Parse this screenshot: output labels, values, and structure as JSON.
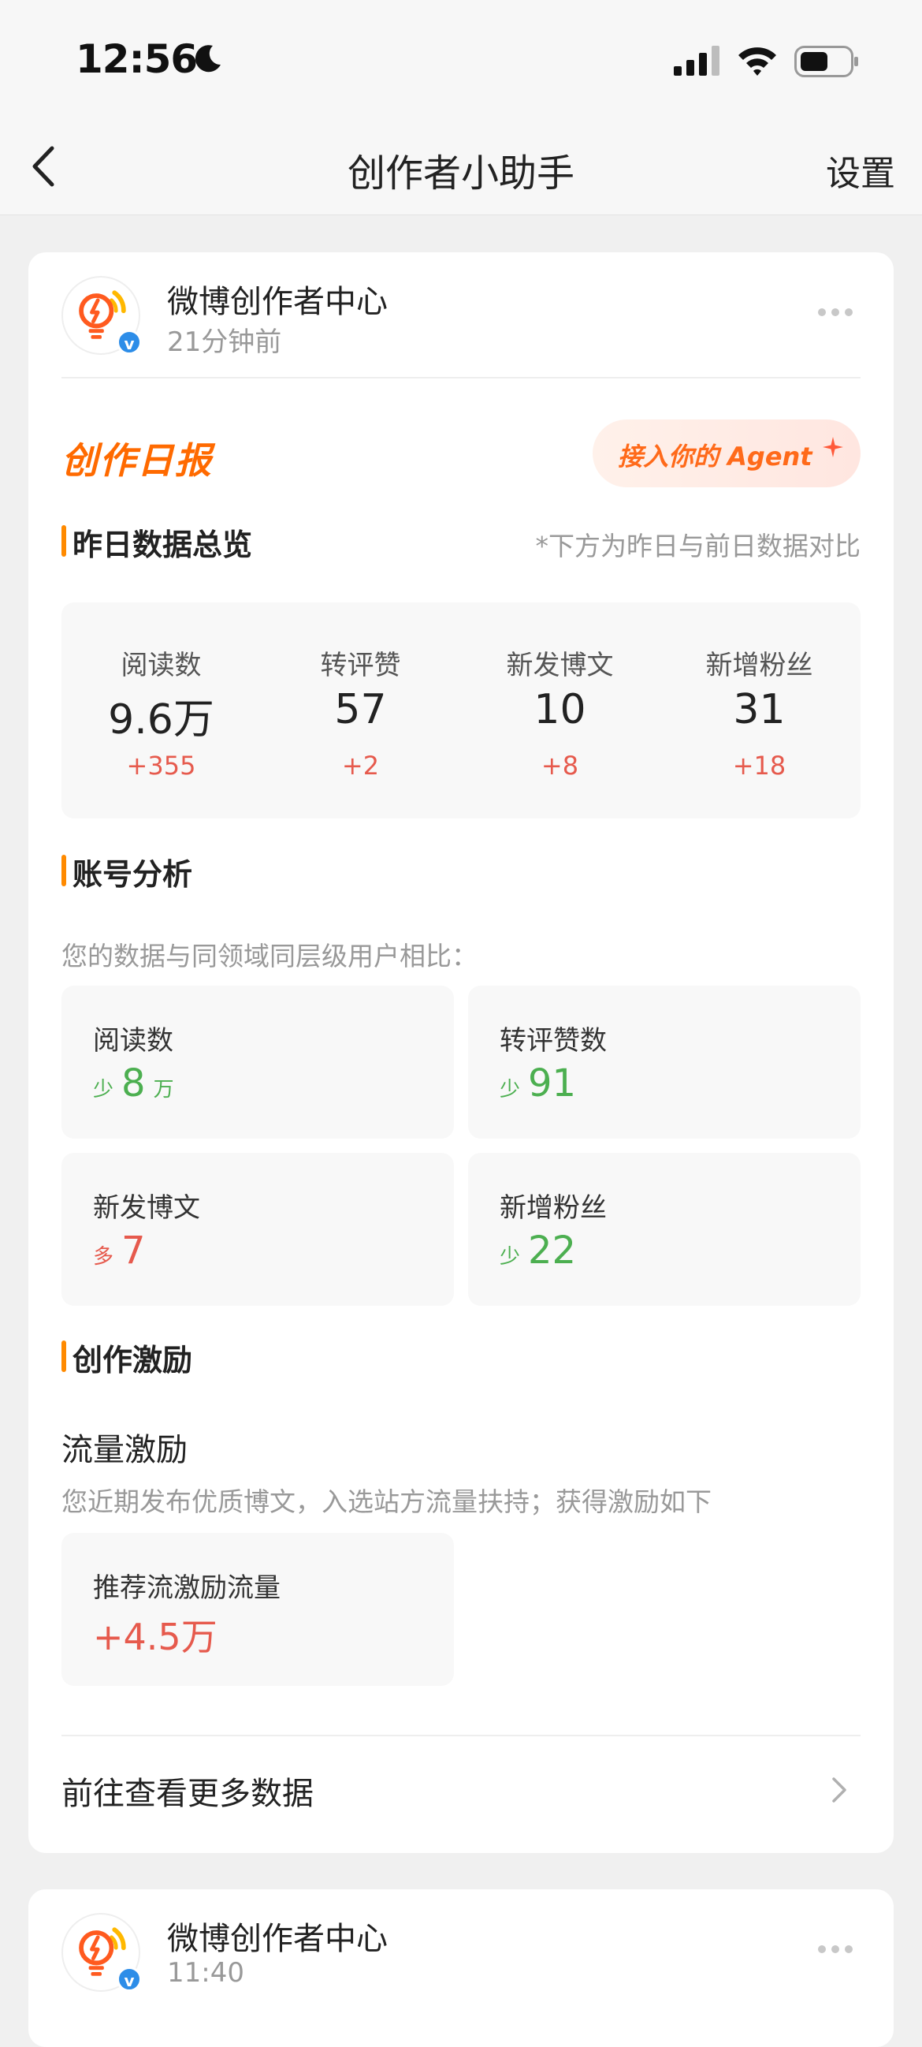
{
  "status_bar": {
    "time": "12:56"
  },
  "nav": {
    "title": "创作者小助手",
    "settings_label": "设置"
  },
  "post1": {
    "account_name": "微博创作者中心",
    "time": "21分钟前",
    "report_title": "创作日报",
    "agent_button": "接入你的 Agent",
    "overview": {
      "title": "昨日数据总览",
      "note": "*下方为昨日与前日数据对比",
      "items": [
        {
          "label": "阅读数",
          "value": "9.6万",
          "delta": "+355"
        },
        {
          "label": "转评赞",
          "value": "57",
          "delta": "+2"
        },
        {
          "label": "新发博文",
          "value": "10",
          "delta": "+8"
        },
        {
          "label": "新增粉丝",
          "value": "31",
          "delta": "+18"
        }
      ]
    },
    "analysis": {
      "title": "账号分析",
      "desc": "您的数据与同领域同层级用户相比：",
      "tiles": [
        {
          "label": "阅读数",
          "prefix": "少",
          "value": "8",
          "unit": "万"
        },
        {
          "label": "转评赞数",
          "prefix": "少",
          "value": "91",
          "unit": ""
        },
        {
          "label": "新发博文",
          "prefix": "多",
          "value": "7",
          "unit": ""
        },
        {
          "label": "新增粉丝",
          "prefix": "少",
          "value": "22",
          "unit": ""
        }
      ]
    },
    "incentive": {
      "title": "创作激励",
      "traffic_title": "流量激励",
      "traffic_desc": "您近期发布优质博文，入选站方流量扶持；获得激励如下",
      "tile_label": "推荐流激励流量",
      "tile_value": "+4.5万"
    },
    "more_link": "前往查看更多数据"
  },
  "post2": {
    "account_name": "微博创作者中心",
    "time": "11:40"
  },
  "colors": {
    "accent": "#ff6a00",
    "section_bar": "#ff8a00",
    "positive_delta": "#e65a4d",
    "less": "#4caf50",
    "verified": "#2d8de8"
  }
}
